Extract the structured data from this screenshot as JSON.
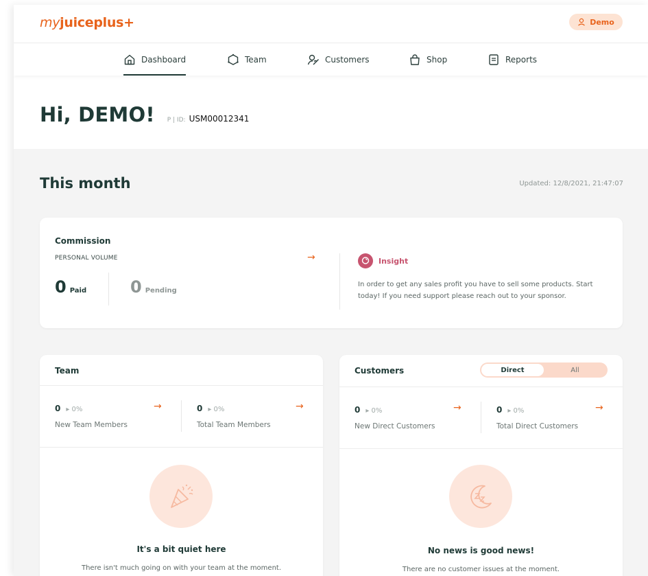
{
  "brand": {
    "prefix": "my",
    "name": "juiceplus+",
    "accent": "#e8631c"
  },
  "user": {
    "label": "Demo",
    "icon": "user-icon"
  },
  "nav": [
    {
      "label": "Dashboard",
      "icon": "home-icon",
      "active": true
    },
    {
      "label": "Team",
      "icon": "team-icon"
    },
    {
      "label": "Customers",
      "icon": "customers-icon"
    },
    {
      "label": "Shop",
      "icon": "shopping-bag-icon"
    },
    {
      "label": "Reports",
      "icon": "reports-icon"
    }
  ],
  "greeting": {
    "title": "Hi, DEMO!",
    "id_prefix": "P | ID:",
    "id_value": "USM00012341"
  },
  "month": {
    "title": "This month",
    "updated": "Updated: 12/8/2021, 21:47:07"
  },
  "commission": {
    "title": "Commission",
    "subtitle": "PERSONAL VOLUME",
    "paid": {
      "value": "0",
      "label": "Paid"
    },
    "pending": {
      "value": "0",
      "label": "Pending"
    },
    "insight": {
      "title": "Insight",
      "text": "In order to get any sales profit you have to sell some products. Start today! If you need support please reach out to your sponsor.",
      "color": "#c7546f"
    }
  },
  "team": {
    "title": "Team",
    "stats": [
      {
        "value": "0",
        "pct": "▸ 0%",
        "label": "New Team Members"
      },
      {
        "value": "0",
        "pct": "▸ 0%",
        "label": "Total Team Members"
      }
    ],
    "empty": {
      "title": "It's a bit quiet here",
      "text": "There isn't much going on with your team at the moment.",
      "icon": "party-popper-icon"
    }
  },
  "customers": {
    "title": "Customers",
    "toggle": {
      "options": [
        "Direct",
        "All"
      ],
      "selected": "Direct"
    },
    "stats": [
      {
        "value": "0",
        "pct": "▸ 0%",
        "label": "New Direct Customers"
      },
      {
        "value": "0",
        "pct": "▸ 0%",
        "label": "Total Direct Customers"
      }
    ],
    "empty": {
      "title": "No news is good news!",
      "text": "There are no customer issues at the moment.",
      "icon": "sleeping-moon-icon"
    }
  },
  "arrow_glyph": "→"
}
